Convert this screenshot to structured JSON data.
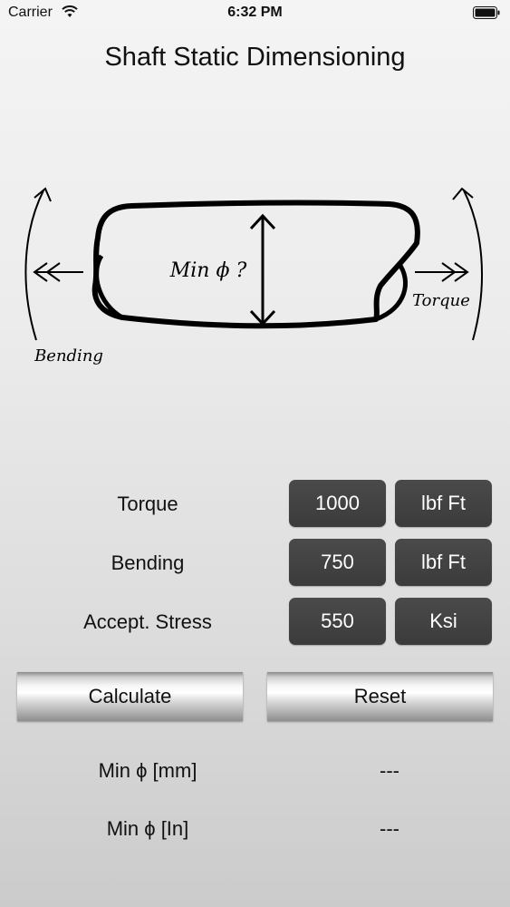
{
  "status_bar": {
    "carrier": "Carrier",
    "time": "6:32 PM",
    "wifi_icon": "wifi-icon",
    "battery_icon": "battery-icon"
  },
  "title": "Shaft Static Dimensioning",
  "diagram": {
    "center_label": "Min ϕ ?",
    "left_label": "Bending",
    "right_label": "Torque"
  },
  "inputs": [
    {
      "label": "Torque",
      "value": "1000",
      "unit": "lbf Ft"
    },
    {
      "label": "Bending",
      "value": "750",
      "unit": "lbf Ft"
    },
    {
      "label": "Accept. Stress",
      "value": "550",
      "unit": "Ksi"
    }
  ],
  "buttons": {
    "calculate": "Calculate",
    "reset": "Reset"
  },
  "results": [
    {
      "label": "Min ϕ [mm]",
      "value": "---"
    },
    {
      "label": "Min ϕ [In]",
      "value": "---"
    }
  ],
  "colors": {
    "pill_bg": "#444444",
    "pill_text": "#ffffff",
    "text": "#111111"
  }
}
